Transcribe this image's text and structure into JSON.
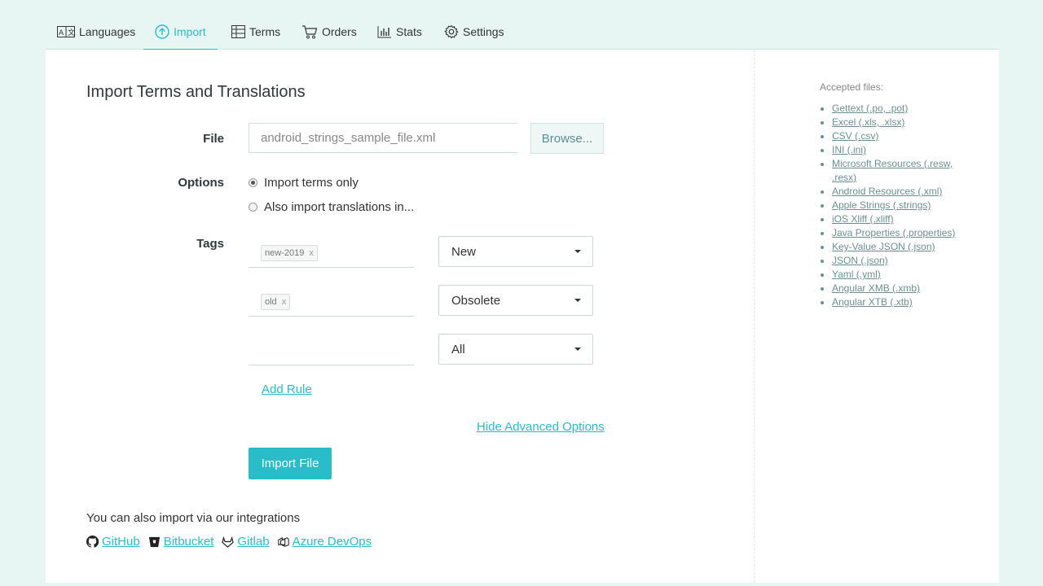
{
  "nav": {
    "tabs": [
      {
        "label": "Languages",
        "icon": "languages-icon"
      },
      {
        "label": "Import",
        "icon": "upload-icon",
        "active": true
      },
      {
        "label": "Terms",
        "icon": "table-icon"
      },
      {
        "label": "Orders",
        "icon": "cart-icon"
      },
      {
        "label": "Stats",
        "icon": "bar-chart-icon"
      },
      {
        "label": "Settings",
        "icon": "gear-icon"
      }
    ]
  },
  "main": {
    "title": "Import Terms and Translations",
    "file": {
      "label": "File",
      "value": "android_strings_sample_file.xml",
      "browse_label": "Browse..."
    },
    "options": {
      "label": "Options",
      "items": [
        {
          "label": "Import terms only",
          "checked": true
        },
        {
          "label": "Also import translations in...",
          "checked": false
        }
      ]
    },
    "tags": {
      "label": "Tags",
      "rules": [
        {
          "tag": "new-2019",
          "remove": "x",
          "select": "New"
        },
        {
          "tag": "old",
          "remove": "x",
          "select": "Obsolete"
        },
        {
          "tag": "",
          "remove": "",
          "select": "All"
        }
      ]
    },
    "add_rule_label": "Add Rule",
    "hide_advanced_label": "Hide Advanced Options",
    "import_button_label": "Import File",
    "integrations_text": "You can also import via our integrations",
    "integrations": [
      {
        "label": "GitHub",
        "icon": "github-icon"
      },
      {
        "label": "Bitbucket",
        "icon": "bitbucket-icon"
      },
      {
        "label": "Gitlab",
        "icon": "gitlab-icon"
      },
      {
        "label": "Azure DevOps",
        "icon": "azure-devops-icon"
      }
    ]
  },
  "sidebar": {
    "title": "Accepted files:",
    "files": [
      "Gettext (.po, .pot)",
      "Excel (.xls, .xlsx)",
      "CSV (.csv)",
      "INI (.ini)",
      "Microsoft Resources (.resw, .resx)",
      "Android Resources (.xml)",
      "Apple Strings (.strings)",
      "iOS Xliff (.xliff)",
      "Java Properties (.properties)",
      "Key-Value JSON (.json)",
      "JSON (.json)",
      "Yaml (.yml)",
      "Angular XMB (.xmb)",
      "Angular XTB (.xtb)"
    ]
  },
  "colors": {
    "accent": "#28bdc8",
    "background": "#e8f6f3",
    "panel": "#ffffff"
  }
}
